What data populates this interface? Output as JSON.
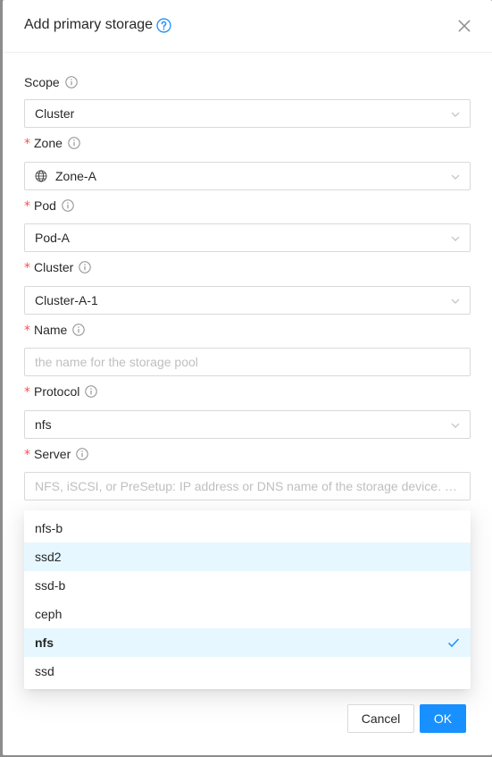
{
  "modal": {
    "title": "Add primary storage",
    "close_icon": "close-icon",
    "help_icon": "question-circle-icon"
  },
  "form": {
    "scope": {
      "label": "Scope",
      "value": "Cluster",
      "required": false
    },
    "zone": {
      "label": "Zone",
      "value": "Zone-A",
      "required": true,
      "icon": "globe-icon"
    },
    "pod": {
      "label": "Pod",
      "value": "Pod-A",
      "required": true
    },
    "cluster": {
      "label": "Cluster",
      "value": "Cluster-A-1",
      "required": true
    },
    "name": {
      "label": "Name",
      "value": "",
      "placeholder": "the name for the storage pool",
      "required": true
    },
    "protocol": {
      "label": "Protocol",
      "value": "nfs",
      "required": true
    },
    "server": {
      "label": "Server",
      "value": "",
      "placeholder": "NFS, iSCSI, or PreSetup: IP address or DNS name of the storage device. …",
      "required": true
    }
  },
  "dropdown": {
    "options": [
      {
        "label": "nfs-b",
        "state": "normal"
      },
      {
        "label": "ssd2",
        "state": "active"
      },
      {
        "label": "ssd-b",
        "state": "normal"
      },
      {
        "label": "ceph",
        "state": "normal"
      },
      {
        "label": "nfs",
        "state": "selected"
      },
      {
        "label": "ssd",
        "state": "normal"
      }
    ],
    "check_icon": "check-icon"
  },
  "footer": {
    "cancel_label": "Cancel",
    "ok_label": "OK"
  },
  "colors": {
    "primary": "#1890ff",
    "required": "#ff4d4f",
    "overlay": "#8c8c8c",
    "option_highlight": "#e6f7ff"
  }
}
